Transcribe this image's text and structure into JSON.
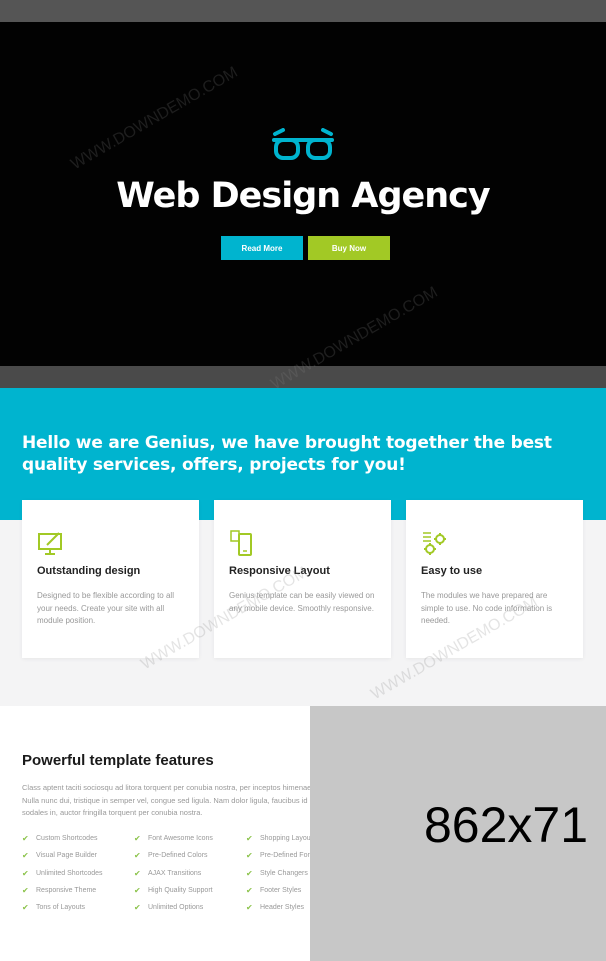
{
  "hero": {
    "title": "Web Design Agency",
    "read_more": "Read More",
    "buy_now": "Buy Now",
    "icon": "glasses-icon"
  },
  "intro": {
    "headline": "Hello we are Genius, we have brought together the best quality services, offers, projects for you!"
  },
  "cards": [
    {
      "icon": "monitor-icon",
      "title": "Outstanding design",
      "body": "Designed to be flexible according to all your needs. Create your site with all module position."
    },
    {
      "icon": "mobile-icon",
      "title": "Responsive Layout",
      "body": "Genius template can be easily viewed on any mobile device. Smoothly responsive."
    },
    {
      "icon": "gears-icon",
      "title": "Easy to use",
      "body": "The modules we have prepared are simple to use. No code information is needed."
    }
  ],
  "features": {
    "title": "Powerful template features",
    "paragraph": "Class aptent taciti sociosqu ad litora torquent per conubia nostra, per inceptos himenaeos. Nulla nunc dui, tristique in semper vel, congue sed ligula. Nam dolor ligula, faucibus id sodales in, auctor fringilla torquent per conubia nostra.",
    "col1": [
      "Custom Shortcodes",
      "Visual Page Builder",
      "Unlimited Shortcodes",
      "Responsive Theme",
      "Tons of Layouts"
    ],
    "col2": [
      "Font Awesome Icons",
      "Pre-Defined Colors",
      "AJAX Transitions",
      "High Quality Support",
      "Unlimited Options"
    ],
    "col3": [
      "Shopping Layouts",
      "Pre-Defined Fonts",
      "Style Changers",
      "Footer Styles",
      "Header Styles"
    ]
  },
  "placeholder": {
    "label": "862x71"
  },
  "watermark": "WWW.DOWNDEMO.COM",
  "colors": {
    "accent": "#00b4cf",
    "lime": "#a2c925",
    "check": "#8bc34a"
  }
}
